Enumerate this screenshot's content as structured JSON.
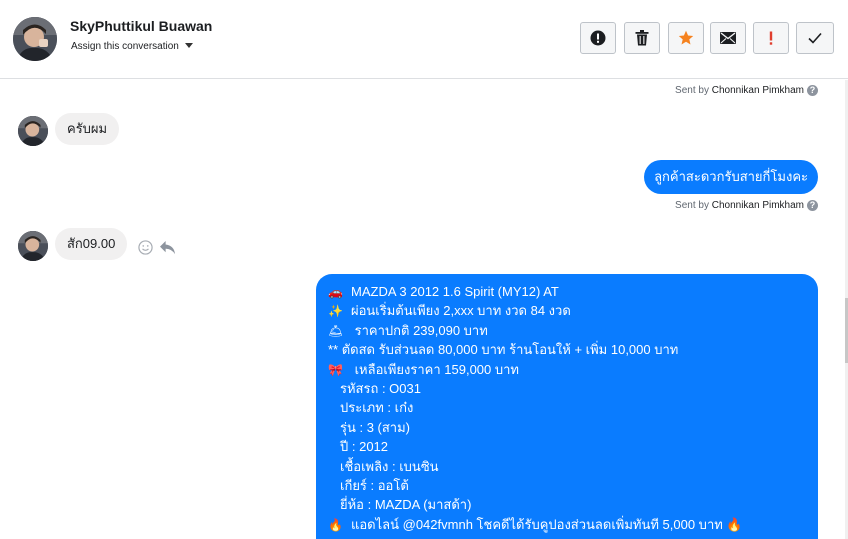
{
  "contact": {
    "name": "SkyPhuttikul Buawan",
    "assign_label": "Assign this conversation"
  },
  "actions": [
    {
      "name": "alert-icon-button",
      "icon": "exclamation-circle-icon"
    },
    {
      "name": "delete-button",
      "icon": "trash-icon"
    },
    {
      "name": "star-button",
      "icon": "star-icon",
      "color": "#f5821f"
    },
    {
      "name": "mail-button",
      "icon": "envelope-icon"
    },
    {
      "name": "spam-button",
      "icon": "exclamation-icon",
      "color": "#e03e2d"
    },
    {
      "name": "done-button",
      "icon": "check-icon"
    }
  ],
  "messages": {
    "sent_by_prefix": "Sent by",
    "sender": "Chonnikan Pimkham",
    "help": "?",
    "in_1": "ครับผม",
    "out_1": "ลูกค้าสะดวกรับสายกี่โมงคะ",
    "in_2": "สัก09.00",
    "big": {
      "lines": [
        {
          "emoji": "🚗",
          "text": "MAZDA 3 2012 1.6 Spirit (MY12) AT"
        },
        {
          "emoji": "✨",
          "text": "ผ่อนเริ่มต้นเพียง 2,xxx บาท งวด 84 งวด"
        },
        {
          "emoji": "🛎",
          "text": " ราคาปกติ 239,090 บาท"
        },
        {
          "emoji": "",
          "text": "** ตัดสด รับส่วนลด 80,000 บาท ร้านโอนให้ + เพิ่ม 10,000 บาท"
        },
        {
          "emoji": "🎀",
          "text": " เหลือเพียงราคา 159,000 บาท"
        },
        {
          "emoji": "",
          "text": "รหัสรถ : O031"
        },
        {
          "emoji": "",
          "text": "ประเภท : เก๋ง"
        },
        {
          "emoji": "",
          "text": "รุ่น : 3 (สาม)"
        },
        {
          "emoji": "",
          "text": "ปี : 2012"
        },
        {
          "emoji": "",
          "text": "เชื้อเพลิง : เบนซิน"
        },
        {
          "emoji": "",
          "text": "เกียร์ : ออโต้"
        },
        {
          "emoji": "",
          "text": "ยี่ห้อ : MAZDA (มาสด้า)"
        },
        {
          "emoji": "🔥",
          "text": "แอดไลน์ @042fvmnh โชคดีได้รับคูปองส่วนลดเพิ่มทันที 5,000 บาท 🔥"
        }
      ]
    }
  }
}
